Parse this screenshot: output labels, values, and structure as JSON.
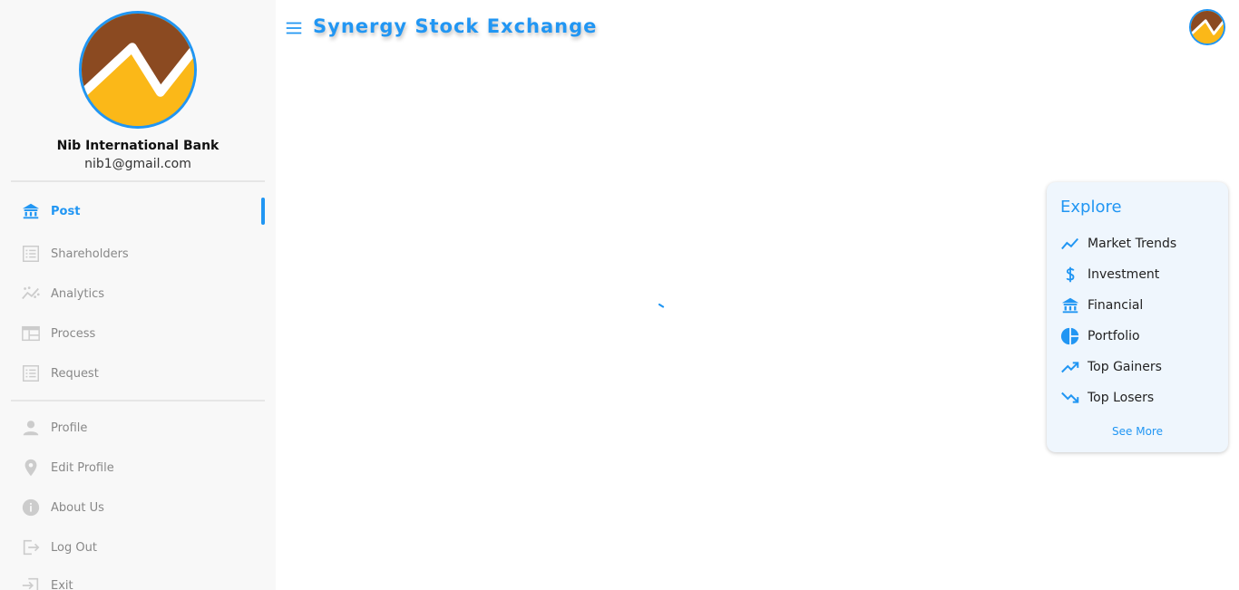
{
  "app": {
    "title": "Synergy Stock Exchange"
  },
  "user": {
    "name": "Nib International Bank",
    "email": "nib1@gmail.com"
  },
  "sidebar": {
    "main_items": [
      {
        "label": "Post",
        "icon": "bank-icon",
        "active": true
      },
      {
        "label": "Shareholders",
        "icon": "list-icon"
      },
      {
        "label": "Analytics",
        "icon": "analytics-icon"
      },
      {
        "label": "Process",
        "icon": "table-layout-icon"
      },
      {
        "label": "Request",
        "icon": "list-icon"
      }
    ],
    "account_items": [
      {
        "label": "Profile",
        "icon": "person-icon"
      },
      {
        "label": "Edit Profile",
        "icon": "location-pin-icon"
      },
      {
        "label": "About Us",
        "icon": "info-icon"
      },
      {
        "label": "Log Out",
        "icon": "logout-icon"
      },
      {
        "label": "Exit",
        "icon": "exit-icon"
      }
    ]
  },
  "explore": {
    "title": "Explore",
    "items": [
      {
        "label": "Market Trends",
        "icon": "trending-line-icon"
      },
      {
        "label": "Investment",
        "icon": "dollar-icon"
      },
      {
        "label": "Financial",
        "icon": "bank-icon"
      },
      {
        "label": "Portfolio",
        "icon": "pie-chart-icon"
      },
      {
        "label": "Top Gainers",
        "icon": "trending-up-icon"
      },
      {
        "label": "Top Losers",
        "icon": "trending-down-icon"
      }
    ],
    "see_more_label": "See More"
  },
  "colors": {
    "accent": "#2196f3",
    "logo_brown": "#8b4a21",
    "logo_yellow": "#fbb818",
    "sidebar_bg": "#f8f8f8",
    "card_bg": "#eff6fd"
  }
}
